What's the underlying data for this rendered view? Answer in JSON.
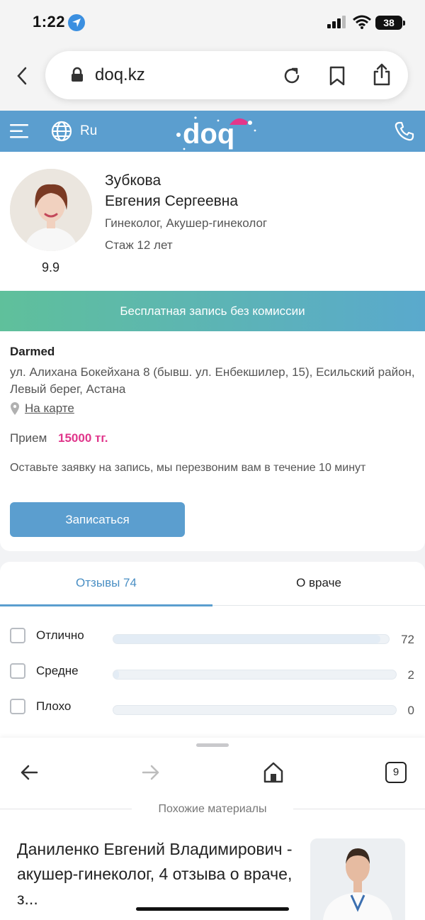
{
  "status_bar": {
    "time": "1:22",
    "battery": "38"
  },
  "browser": {
    "url": "doq.kz"
  },
  "site_header": {
    "language": "Ru",
    "logo_text": "doq"
  },
  "doctor": {
    "last_name": "Зубкова",
    "first_names": "Евгения Сергеевна",
    "specialty": "Гинеколог, Акушер-гинеколог",
    "experience": "Стаж 12 лет",
    "rating": "9.9"
  },
  "banner": {
    "text": "Бесплатная запись без комиссии"
  },
  "clinic": {
    "name": "Darmed",
    "address": "ул. Алихана Бокейхана 8 (бывш. ул. Енбекшилер, 15), Есильский район, Левый берег, Астана",
    "map_link": "На карте",
    "price_label": "Прием",
    "price_value": "15000 тг.",
    "callback_note": "Оставьте заявку на запись, мы перезвоним вам в течение 10 минут",
    "book_button": "Записаться"
  },
  "tabs": {
    "reviews": "Отзывы 74",
    "about": "О враче"
  },
  "reviews": [
    {
      "label": "Отлично",
      "count": "72",
      "fraction": 0.97
    },
    {
      "label": "Средне",
      "count": "2",
      "fraction": 0.02
    },
    {
      "label": "Плохо",
      "count": "0",
      "fraction": 0.0
    }
  ],
  "bottom_sheet": {
    "tab_count": "9",
    "similar_label": "Похожие материалы",
    "article_title": "Даниленко Евгений Владимирович - акушер-гинеколог, 4 отзыва о враче, з..."
  }
}
